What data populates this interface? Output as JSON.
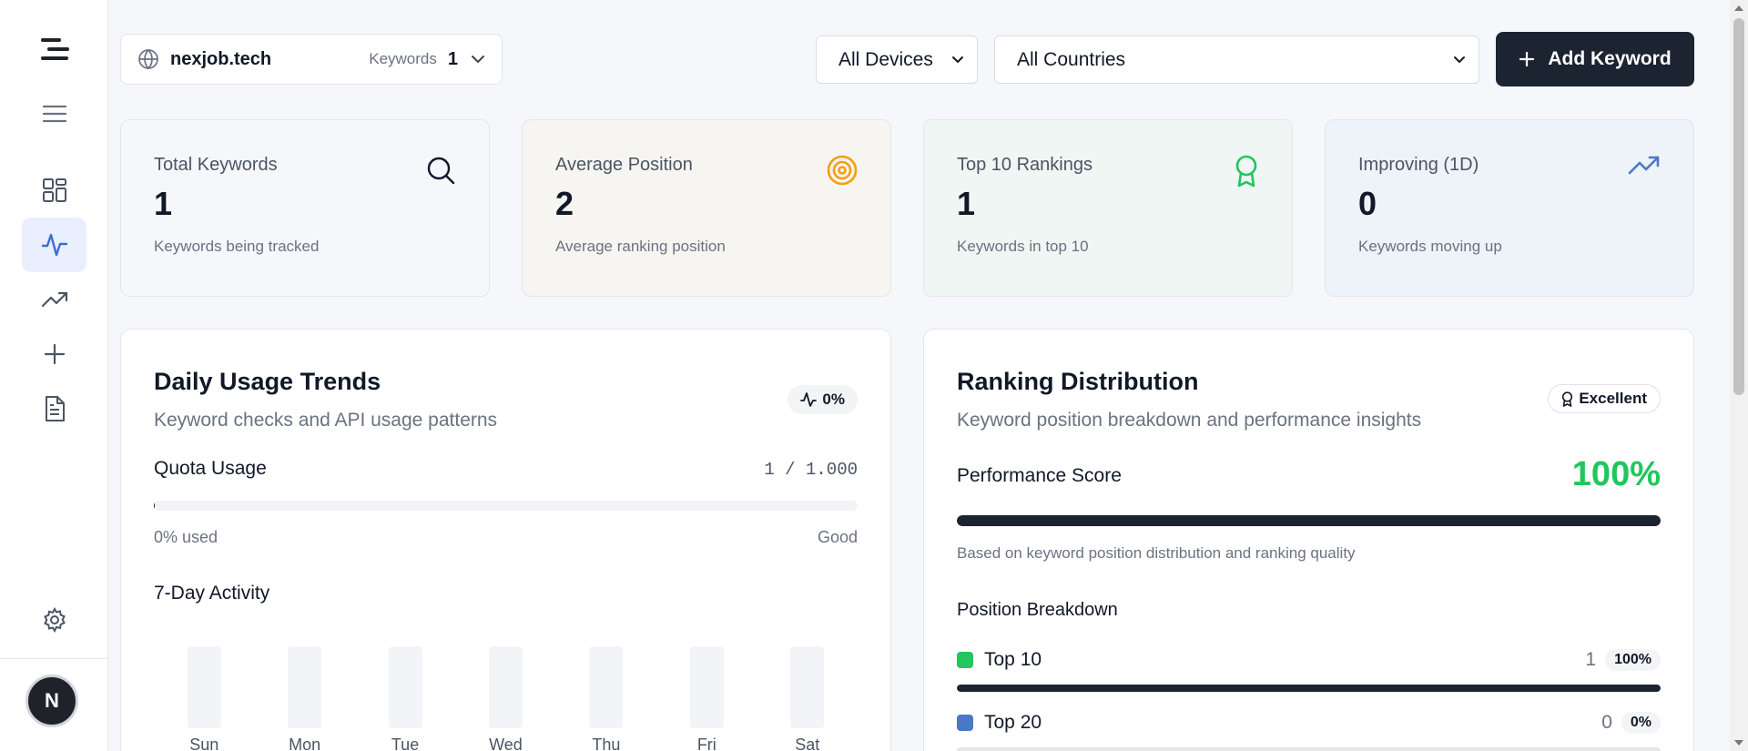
{
  "sidebar": {
    "items": [
      {
        "name": "logo-icon"
      },
      {
        "name": "menu-icon"
      },
      {
        "name": "dashboard-icon"
      },
      {
        "name": "activity-icon",
        "active": true
      },
      {
        "name": "trending-icon"
      },
      {
        "name": "plus-icon"
      },
      {
        "name": "document-icon"
      },
      {
        "name": "settings-icon"
      }
    ],
    "avatar_letter": "N"
  },
  "header": {
    "site": "nexjob.tech",
    "keywords_label": "Keywords",
    "keywords_count": "1",
    "device_filter": "All Devices",
    "country_filter": "All Countries",
    "add_keyword_label": "Add Keyword"
  },
  "stats": [
    {
      "title": "Total Keywords",
      "value": "1",
      "sub": "Keywords being tracked",
      "icon": "search-icon",
      "bg": "#f5f7fb",
      "icon_color": "#111827"
    },
    {
      "title": "Average Position",
      "value": "2",
      "sub": "Average ranking position",
      "icon": "target-icon",
      "bg": "#f6f5f1",
      "icon_color": "#f59e0b"
    },
    {
      "title": "Top 10 Rankings",
      "value": "1",
      "sub": "Keywords in top 10",
      "icon": "award-icon",
      "bg": "#eff6f3",
      "icon_color": "#22c55e"
    },
    {
      "title": "Improving (1D)",
      "value": "0",
      "sub": "Keywords moving up",
      "icon": "trending-up-icon",
      "bg": "#eef2f9",
      "icon_color": "#4a78c9"
    }
  ],
  "usage": {
    "title": "Daily Usage Trends",
    "subtitle": "Keyword checks and API usage patterns",
    "trend_badge": "0%",
    "quota_label": "Quota Usage",
    "quota_value": "1 / 1.000",
    "quota_fraction": 0.001,
    "quota_used": "0% used",
    "quota_status": "Good",
    "activity_title": "7-Day Activity",
    "days": [
      {
        "label": "Sun",
        "value": 0
      },
      {
        "label": "Mon",
        "value": 0
      },
      {
        "label": "Tue",
        "value": 0
      },
      {
        "label": "Wed",
        "value": 0
      },
      {
        "label": "Thu",
        "value": 0
      },
      {
        "label": "Fri",
        "value": 0
      },
      {
        "label": "Sat",
        "value": 0
      }
    ]
  },
  "distribution": {
    "title": "Ranking Distribution",
    "subtitle": "Keyword position breakdown and performance insights",
    "badge": "Excellent",
    "perf_label": "Performance Score",
    "perf_value": "100%",
    "perf_fraction": 1.0,
    "perf_note": "Based on keyword position distribution and ranking quality",
    "breakdown_title": "Position Breakdown",
    "rows": [
      {
        "label": "Top 10",
        "count": "1",
        "pct": "100%",
        "fraction": 1.0,
        "color": "#22c55e"
      },
      {
        "label": "Top 20",
        "count": "0",
        "pct": "0%",
        "fraction": 0.0,
        "color": "#4a78c9"
      }
    ]
  }
}
